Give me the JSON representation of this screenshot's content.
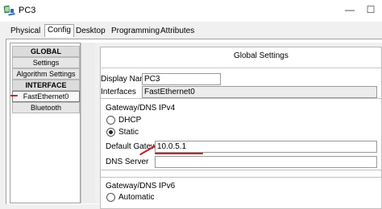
{
  "window": {
    "title": "PC3",
    "minimize_glyph": "—",
    "maximize_glyph": "☐"
  },
  "tabs": [
    {
      "label": "Physical"
    },
    {
      "label": "Config"
    },
    {
      "label": "Desktop"
    },
    {
      "label": "Programming"
    },
    {
      "label": "Attributes"
    }
  ],
  "active_tab": "Config",
  "sidebar": {
    "items": [
      {
        "label": "GLOBAL"
      },
      {
        "label": "Settings"
      },
      {
        "label": "Algorithm Settings"
      },
      {
        "label": "INTERFACE"
      },
      {
        "label": "FastEthernet0"
      },
      {
        "label": "Bluetooth"
      }
    ],
    "selected": "FastEthernet0"
  },
  "main": {
    "section_title": "Global Settings",
    "display_name": {
      "label": "Display Name",
      "value": "PC3"
    },
    "interfaces": {
      "label": "Interfaces",
      "value": "FastEthernet0"
    },
    "ipv4_group": {
      "title": "Gateway/DNS IPv4",
      "dhcp_label": "DHCP",
      "static_label": "Static",
      "selected": "Static",
      "default_gateway_label": "Default Gateway",
      "default_gateway_value": "10.0.5.1",
      "dns_server_label": "DNS Server",
      "dns_server_value": ""
    },
    "ipv6_group": {
      "title": "Gateway/DNS IPv6",
      "automatic_label": "Automatic"
    }
  },
  "colors": {
    "annotation_red": "#d3141c",
    "window_bg": "#f0f0f0",
    "icon_green": "#3a9a4a",
    "icon_blue": "#2f6fb5"
  }
}
